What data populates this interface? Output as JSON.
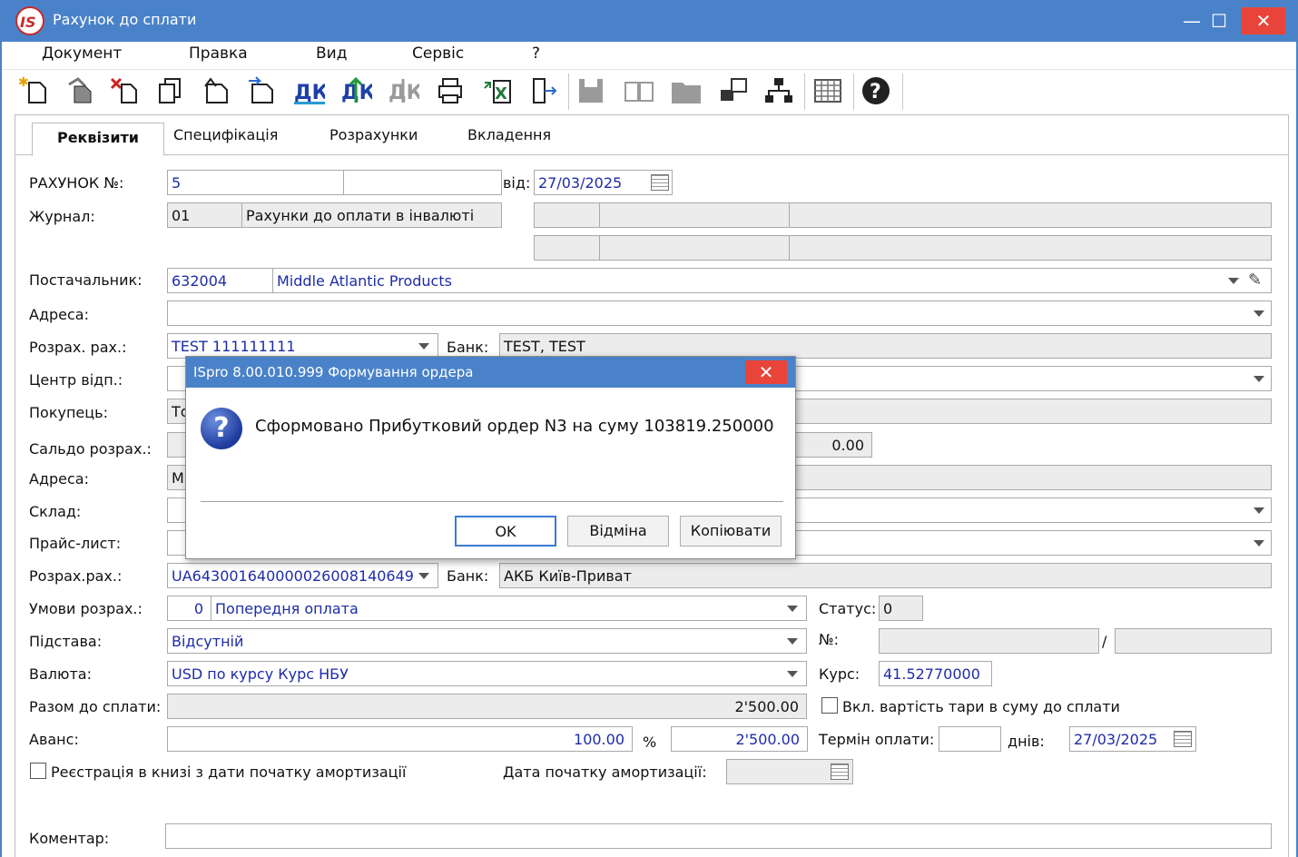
{
  "window": {
    "title": "Рахунок до сплати",
    "minimize": "—",
    "maximize": "☐",
    "close": "✕"
  },
  "menu": [
    "Документ",
    "Правка",
    "Вид",
    "Сервіс",
    "?"
  ],
  "toolbar_icons": [
    "new-doc-icon",
    "copy-doc-icon",
    "delete-doc-icon",
    "duplicate-icon",
    "doc-up-icon",
    "doc-forward-icon",
    "debit-credit-icon",
    "debit-credit-post-icon",
    "debit-credit-cancel-icon",
    "print-icon",
    "excel-export-icon",
    "exit-icon",
    "save-icon",
    "book-icon",
    "folder-icon",
    "transfer-icon",
    "hierarchy-icon",
    "grid-icon",
    "help-icon"
  ],
  "tabs": [
    "Реквізити",
    "Специфікація",
    "Розрахунки",
    "Вкладення"
  ],
  "form": {
    "invoice_label": "РАХУНОК №:",
    "invoice_no": "5",
    "invoice_suffix": "",
    "date_label": "від:",
    "date": "27/03/2025",
    "journal_label": "Журнал:",
    "journal_code": "01",
    "journal_name": "Рахунки до оплати в інвалюті",
    "supplier_label": "Постачальник:",
    "supplier_code": "632004",
    "supplier_name": "Middle Atlantic Products",
    "address_label": "Адреса:",
    "address": "",
    "account_label": "Розрах. рах.:",
    "account": "TEST 111111111",
    "bank_label": "Банк:",
    "bank": "TEST, TEST",
    "center_label": "Центр відп.:",
    "buyer_label": "Покупець:",
    "buyer_partial": "То",
    "balance_label": "Сальдо розрах.:",
    "balance": "0.00",
    "buyer_address_label": "Адреса:",
    "buyer_address_partial": "М",
    "warehouse_label": "Склад:",
    "pricelist_label": "Прайс-лист:",
    "buyer_account_label": "Розрах.рах.:",
    "buyer_account": "UA643001640000026008140649",
    "buyer_bank_label": "Банк:",
    "buyer_bank": "АКБ Київ-Приват",
    "terms_label": "Умови розрах.:",
    "terms_code": "0",
    "terms_name": "Попередня оплата",
    "status_label": "Статус:",
    "status": "0",
    "basis_label": "Підстава:",
    "basis": "Відсутній",
    "no_label": "№:",
    "slash": "/",
    "currency_label": "Валюта:",
    "currency": "USD по курсу Курс НБУ",
    "rate_label": "Курс:",
    "rate": "41.52770000",
    "total_label": "Разом до сплати:",
    "total": "2'500.00",
    "tare_label": "Вкл. вартість тари в суму до сплати",
    "advance_label": "Аванс:",
    "advance_pct": "100.00",
    "pct_sign": "%",
    "advance_sum": "2'500.00",
    "term_label": "Термін оплати:",
    "term_days": "",
    "days_label": "днів:",
    "term_date": "27/03/2025",
    "register_label": "Реєстрація в книзі з дати початку амортизації",
    "amort_date_label": "Дата початку амортизації:",
    "comment_label": "Коментар:"
  },
  "dialog": {
    "title": "ISpro 8.00.010.999 Формування ордера",
    "close": "✕",
    "icon": "question-icon",
    "icon_glyph": "?",
    "message": "Сформовано Прибутковий ордер N3 на суму 103819.250000",
    "ok": "OK",
    "cancel": "Відміна",
    "copy": "Копіювати"
  },
  "colors": {
    "titlebar": "#4a82c9",
    "close": "#e8443a",
    "value_text": "#1d2ca8"
  }
}
